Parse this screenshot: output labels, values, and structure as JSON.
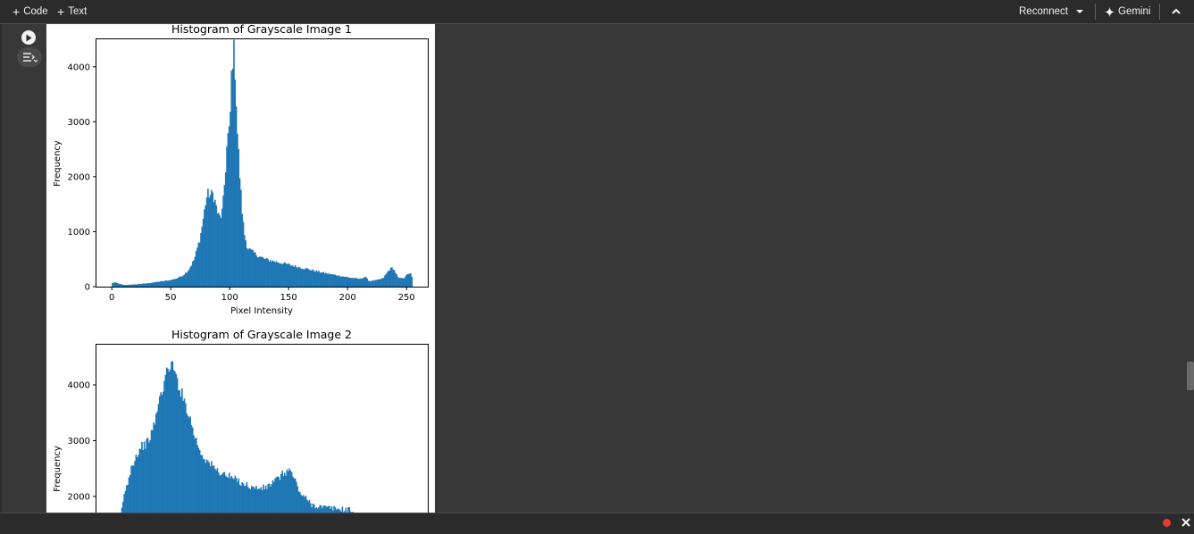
{
  "toolbar": {
    "code_label": "Code",
    "text_label": "Text",
    "reconnect_label": "Reconnect",
    "gemini_label": "Gemini"
  },
  "colors": {
    "bar": "#1f77b4",
    "background": "#383838",
    "toolbar": "#2b2b2b",
    "record_dot": "#e53935"
  },
  "icons": [
    "plus-icon",
    "chevron-down-icon",
    "sparkle-icon",
    "chevron-up-icon",
    "play-icon",
    "output-options-icon",
    "record-icon",
    "close-icon"
  ],
  "chart_data": [
    {
      "type": "bar",
      "title": "Histogram of Grayscale Image 1",
      "xlabel": "Pixel Intensity",
      "ylabel": "Frequency",
      "xlim": [
        -13,
        268
      ],
      "ylim": [
        0,
        4500
      ],
      "xticks": [
        0,
        50,
        100,
        150,
        200,
        250
      ],
      "yticks": [
        0,
        1000,
        2000,
        3000,
        4000
      ],
      "anchors": [
        [
          0,
          60
        ],
        [
          2,
          80
        ],
        [
          5,
          60
        ],
        [
          10,
          30
        ],
        [
          20,
          40
        ],
        [
          30,
          60
        ],
        [
          40,
          90
        ],
        [
          50,
          120
        ],
        [
          55,
          150
        ],
        [
          60,
          200
        ],
        [
          65,
          300
        ],
        [
          70,
          500
        ],
        [
          75,
          900
        ],
        [
          78,
          1300
        ],
        [
          80,
          1600
        ],
        [
          82,
          1700
        ],
        [
          84,
          1650
        ],
        [
          86,
          1700
        ],
        [
          88,
          1500
        ],
        [
          90,
          1300
        ],
        [
          92,
          1250
        ],
        [
          94,
          1400
        ],
        [
          96,
          2000
        ],
        [
          98,
          2700
        ],
        [
          100,
          2800
        ],
        [
          101,
          3500
        ],
        [
          102,
          4150
        ],
        [
          103,
          4270
        ],
        [
          104,
          4200
        ],
        [
          105,
          3800
        ],
        [
          106,
          3000
        ],
        [
          108,
          2200
        ],
        [
          110,
          1500
        ],
        [
          112,
          1000
        ],
        [
          115,
          700
        ],
        [
          120,
          620
        ],
        [
          125,
          550
        ],
        [
          130,
          500
        ],
        [
          140,
          450
        ],
        [
          150,
          400
        ],
        [
          160,
          350
        ],
        [
          170,
          300
        ],
        [
          180,
          250
        ],
        [
          190,
          210
        ],
        [
          200,
          170
        ],
        [
          210,
          140
        ],
        [
          215,
          180
        ],
        [
          218,
          100
        ],
        [
          225,
          120
        ],
        [
          230,
          150
        ],
        [
          235,
          300
        ],
        [
          238,
          350
        ],
        [
          240,
          280
        ],
        [
          243,
          150
        ],
        [
          248,
          160
        ],
        [
          252,
          250
        ],
        [
          254,
          220
        ],
        [
          255,
          120
        ]
      ],
      "noise": 0.07
    },
    {
      "type": "bar",
      "title": "Histogram of Grayscale Image 2",
      "xlabel": "",
      "ylabel": "Frequency",
      "xlim": [
        -13,
        268
      ],
      "ylim": [
        1550,
        4720
      ],
      "xticks": [],
      "yticks": [
        2000,
        3000,
        4000
      ],
      "anchors": [
        [
          5,
          1400
        ],
        [
          8,
          1700
        ],
        [
          10,
          2000
        ],
        [
          13,
          2200
        ],
        [
          16,
          2500
        ],
        [
          20,
          2700
        ],
        [
          25,
          2900
        ],
        [
          30,
          2950
        ],
        [
          35,
          3200
        ],
        [
          40,
          3700
        ],
        [
          45,
          4100
        ],
        [
          48,
          4300
        ],
        [
          50,
          4400
        ],
        [
          52,
          4300
        ],
        [
          55,
          4100
        ],
        [
          60,
          3800
        ],
        [
          65,
          3500
        ],
        [
          70,
          3100
        ],
        [
          75,
          2800
        ],
        [
          80,
          2650
        ],
        [
          90,
          2450
        ],
        [
          100,
          2350
        ],
        [
          110,
          2250
        ],
        [
          120,
          2150
        ],
        [
          130,
          2150
        ],
        [
          140,
          2300
        ],
        [
          145,
          2400
        ],
        [
          150,
          2480
        ],
        [
          153,
          2400
        ],
        [
          156,
          2250
        ],
        [
          160,
          2050
        ],
        [
          165,
          1950
        ],
        [
          170,
          1850
        ],
        [
          180,
          1800
        ],
        [
          190,
          1780
        ],
        [
          200,
          1760
        ],
        [
          205,
          1750
        ],
        [
          206,
          1400
        ]
      ],
      "noise": 0.03
    }
  ]
}
